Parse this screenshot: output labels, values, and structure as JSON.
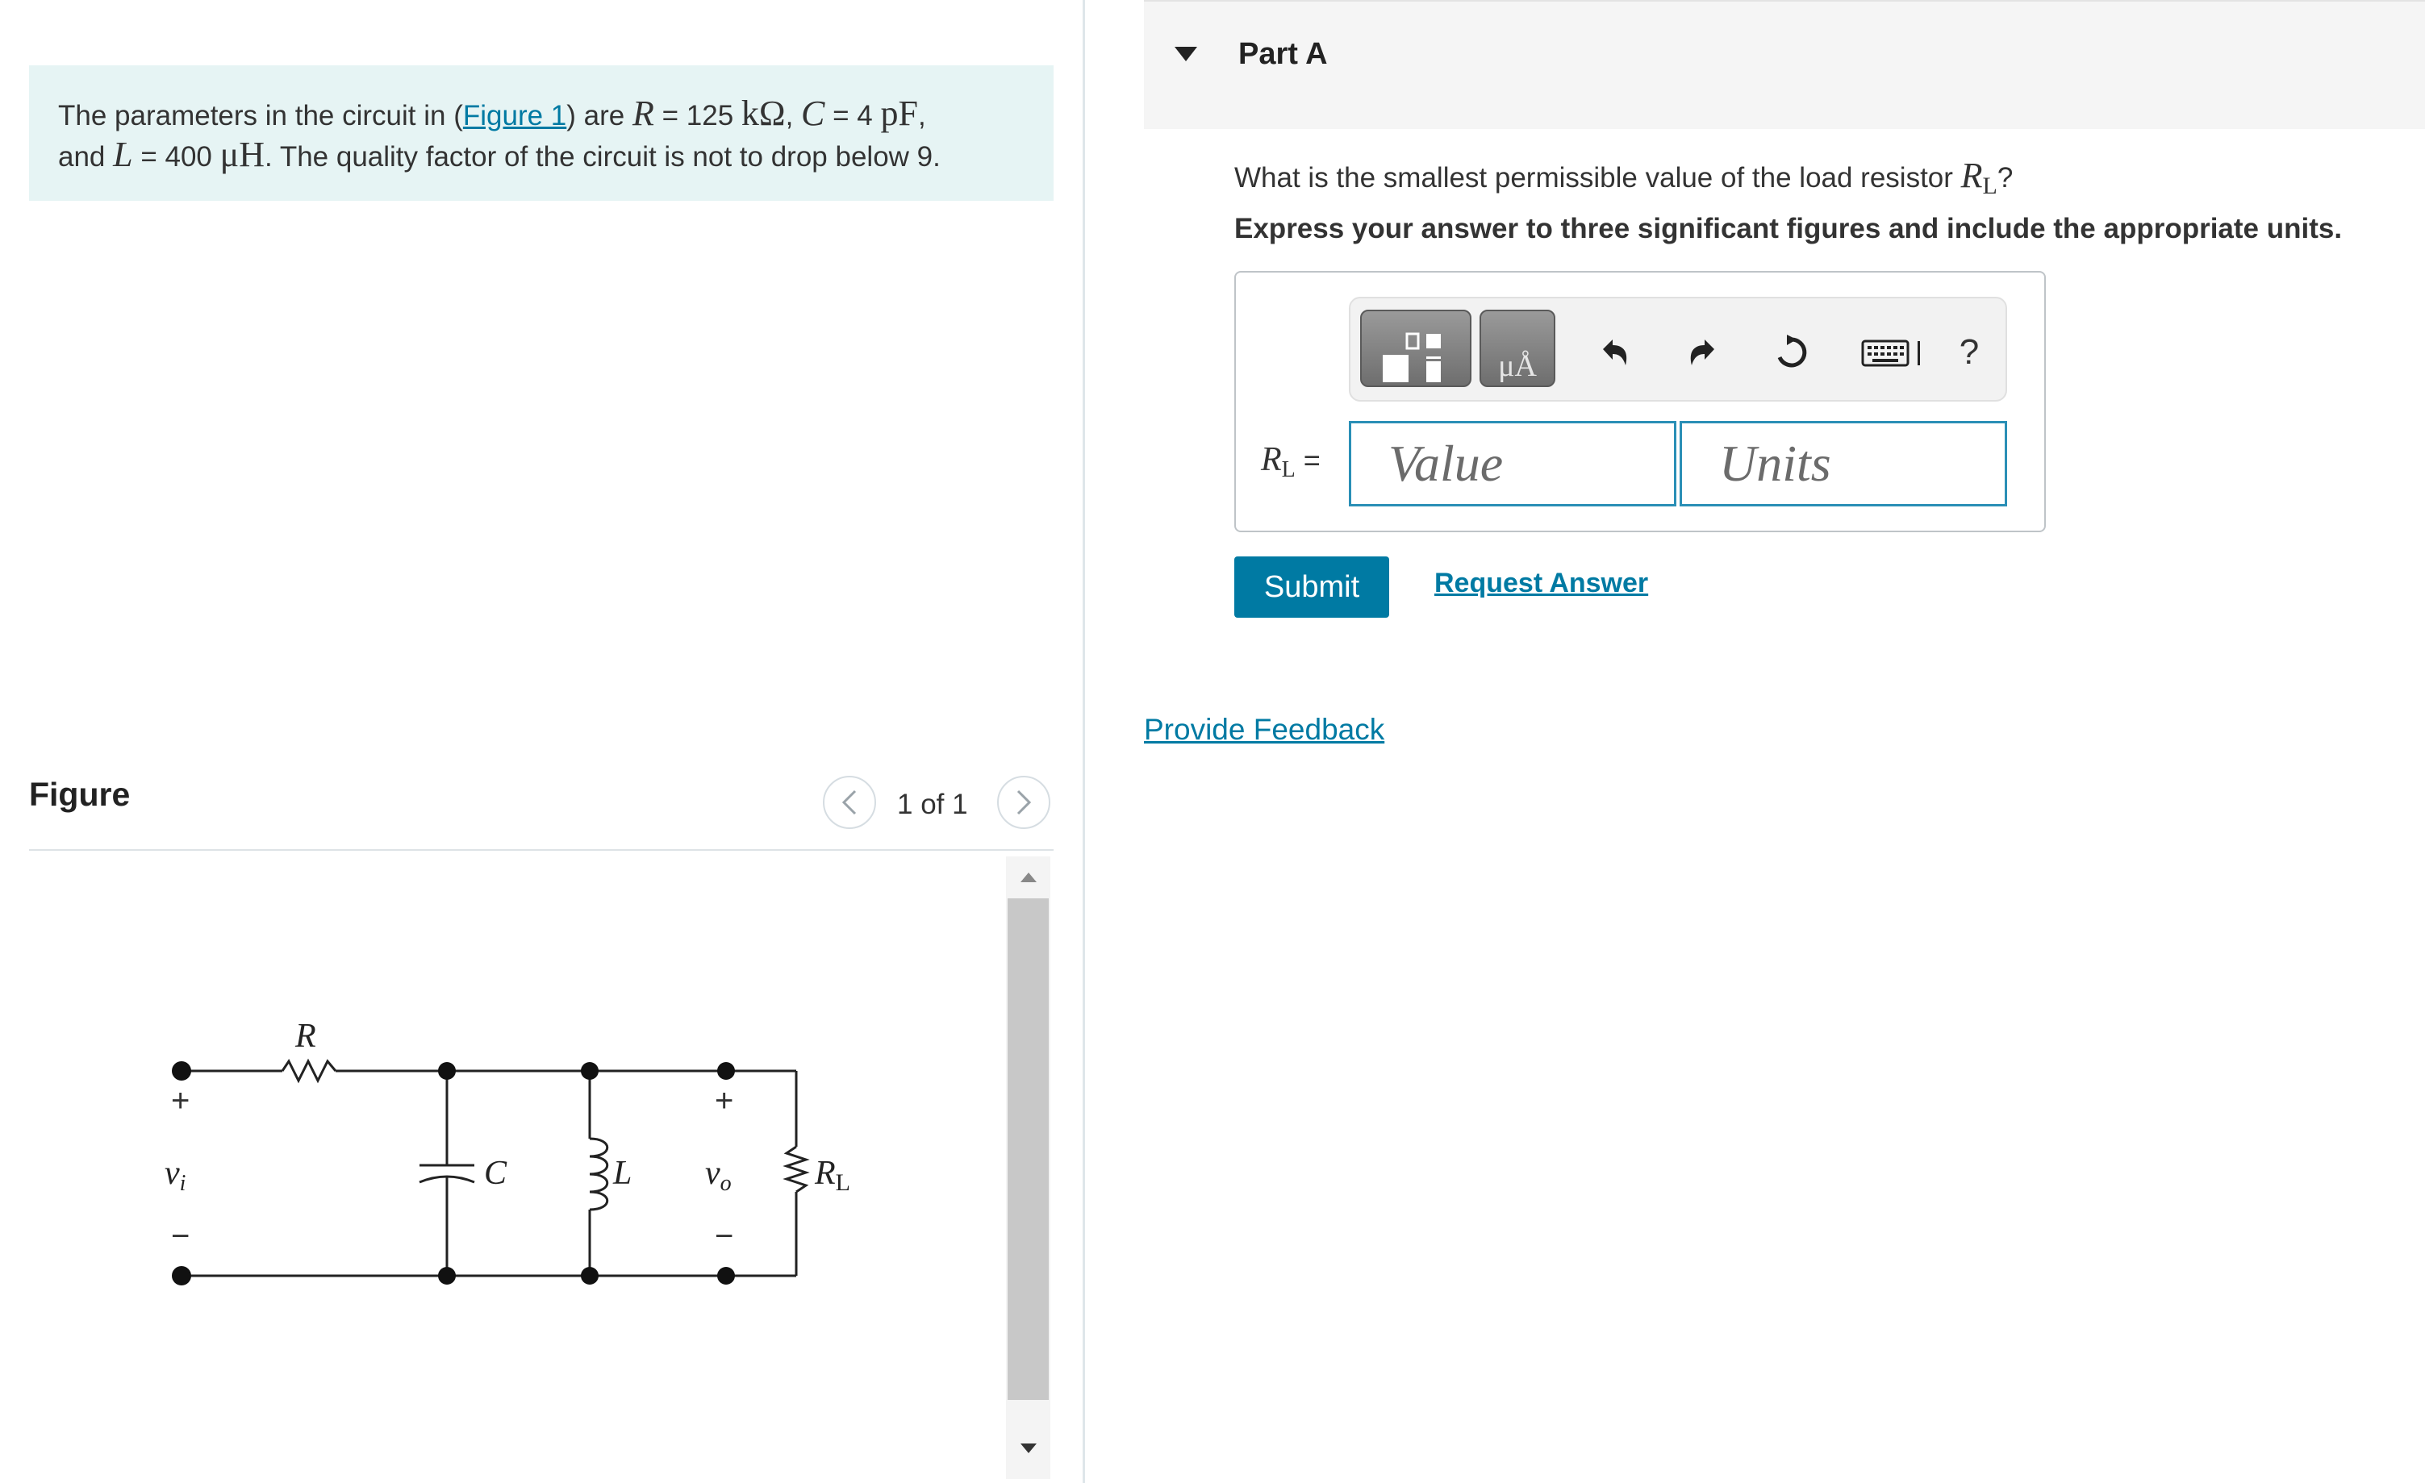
{
  "intro": {
    "text_1": "The parameters in the circuit in (",
    "figure_link": "Figure 1",
    "text_2": ") are ",
    "r_symbol": "R",
    "r_value": " = 125 ",
    "r_unit": "kΩ",
    "sep1": ", ",
    "c_symbol": "C",
    "c_value": " = 4 ",
    "c_unit": "pF",
    "sep2": ",",
    "text_3": "and ",
    "l_symbol": "L",
    "l_value": " = 400 ",
    "l_unit": "μH",
    "text_4": ". The quality factor of the circuit is not to drop below 9."
  },
  "figure": {
    "title": "Figure",
    "page_indicator": "1 of 1",
    "prev_icon": "chevron-left-icon",
    "next_icon": "chevron-right-icon",
    "circuit_labels": {
      "r": "R",
      "c": "C",
      "l": "L",
      "rl_main": "R",
      "rl_sub": "L",
      "vi_main": "v",
      "vi_sub": "i",
      "vo_main": "v",
      "vo_sub": "o",
      "plus": "+",
      "minus": "−"
    }
  },
  "part": {
    "title": "Part A",
    "caret_icon": "caret-down-icon",
    "question_text": "What is the smallest permissible value of the load resistor ",
    "question_symbol": "R",
    "question_sub": "L",
    "question_end": "?",
    "instruction": "Express your answer to three significant figures and include the appropriate units."
  },
  "answer": {
    "label_symbol": "R",
    "label_sub": "L",
    "label_eq": " =",
    "value_placeholder": "Value",
    "units_placeholder": "Units",
    "units_btn_glyph": "μÅ",
    "help_glyph": "?",
    "toolbar_icons": [
      "templates-icon",
      "units-icon",
      "undo-icon",
      "redo-icon",
      "reset-icon",
      "keyboard-icon",
      "help-icon"
    ]
  },
  "actions": {
    "submit": "Submit",
    "request_answer": "Request Answer",
    "provide_feedback": "Provide Feedback"
  },
  "colors": {
    "accent": "#007aa3",
    "intro_bg": "#e6f4f4",
    "input_border": "#2a8fb6"
  }
}
